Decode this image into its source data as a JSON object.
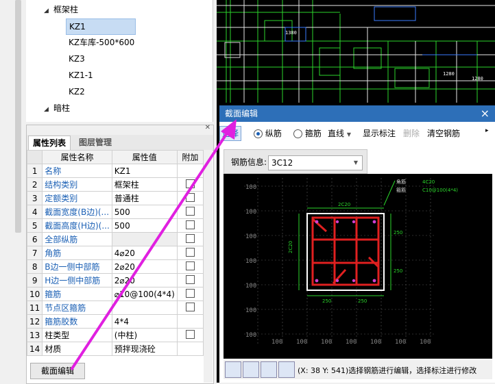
{
  "tree": {
    "nodes": [
      {
        "label": "框架柱",
        "expanded": true
      },
      {
        "label": "KZ1",
        "selected": true
      },
      {
        "label": "KZ车库-500*600"
      },
      {
        "label": "KZ3"
      },
      {
        "label": "KZ1-1"
      },
      {
        "label": "KZ2"
      },
      {
        "label": "暗柱",
        "expanded": true
      }
    ]
  },
  "property_panel": {
    "tabs": [
      "属性列表",
      "图层管理"
    ],
    "headers": [
      "属性名称",
      "属性值",
      "附加"
    ],
    "rows": [
      {
        "n": "1",
        "name": "名称",
        "value": "KZ1",
        "blue": true,
        "cb": false
      },
      {
        "n": "2",
        "name": "结构类别",
        "value": "框架柱",
        "blue": true,
        "cb": true
      },
      {
        "n": "3",
        "name": "定额类别",
        "value": "普通柱",
        "blue": true,
        "cb": true
      },
      {
        "n": "4",
        "name": "截面宽度(B边)(...",
        "value": "500",
        "blue": true,
        "cb": true
      },
      {
        "n": "5",
        "name": "截面高度(H边)(...",
        "value": "500",
        "blue": true,
        "cb": true
      },
      {
        "n": "6",
        "name": "全部纵筋",
        "value": "",
        "blue": true,
        "cb": true,
        "grey": true
      },
      {
        "n": "7",
        "name": "角筋",
        "value": "4⌀20",
        "blue": true,
        "cb": true
      },
      {
        "n": "8",
        "name": "B边一侧中部筋",
        "value": "2⌀20",
        "blue": true,
        "cb": true
      },
      {
        "n": "9",
        "name": "H边一侧中部筋",
        "value": "2⌀20",
        "blue": true,
        "cb": true
      },
      {
        "n": "10",
        "name": "箍筋",
        "value": "⌀10@100(4*4)",
        "blue": true,
        "cb": true
      },
      {
        "n": "11",
        "name": "节点区箍筋",
        "value": "",
        "blue": true,
        "cb": true
      },
      {
        "n": "12",
        "name": "箍筋胶数",
        "value": "4*4",
        "blue": true,
        "cb": false
      },
      {
        "n": "13",
        "name": "柱类型",
        "value": "(中柱)",
        "blue": false,
        "cb": true
      },
      {
        "n": "14",
        "name": "材质",
        "value": "预拌现浇砼",
        "blue": false,
        "cb": false
      }
    ],
    "button_label": "截面编辑"
  },
  "dialog": {
    "title": "截面编辑",
    "close": "×",
    "toolbar": {
      "select": "选择",
      "radio_longitudinal": "纵筋",
      "radio_stirrup": "箍筋",
      "line_type": "直线",
      "show_labels": "显示标注",
      "delete": "删除",
      "clear": "清空钢筋",
      "more": "▸"
    },
    "rebar_info_label": "钢筋信息:",
    "rebar_info_value": "3C12",
    "canvas_labels": {
      "corner_label": "角筋",
      "stirrup_label": "箍筋",
      "corner_text": "4C20",
      "stirrup_text": "C10@100(4*4)",
      "top_dim": "2C20",
      "left_dim": "2C20",
      "dim_250": "250",
      "ruler_100": "100"
    },
    "status": "(X: 38 Y: 541)选择钢筋进行编辑，选择标注进行修改"
  },
  "colors": {
    "accent": "#2d6fb8",
    "rebar": "#e02020",
    "selected_row": "#c7dcf3"
  }
}
